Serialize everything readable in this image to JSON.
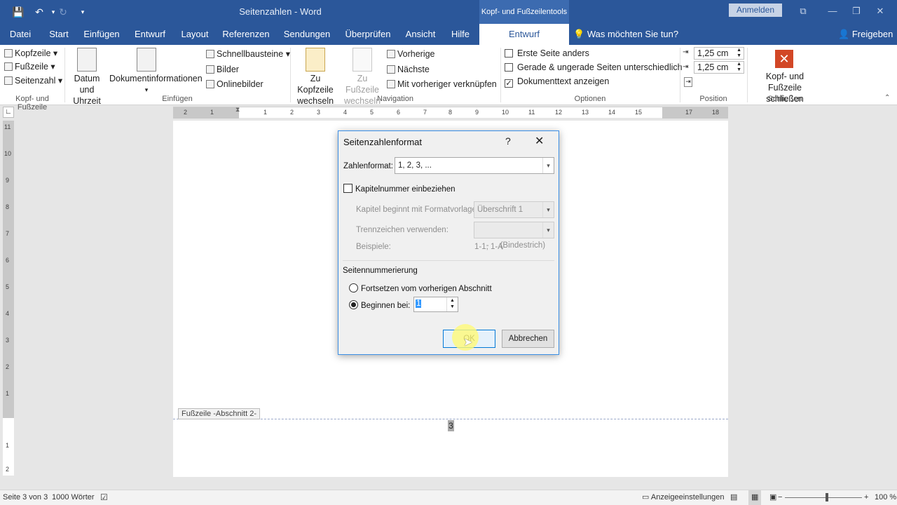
{
  "titlebar": {
    "doc_title": "Seitenzahlen  -  Word",
    "context_header": "Kopf- und Fußzeilentools",
    "signin": "Anmelden"
  },
  "tabs": [
    "Datei",
    "Start",
    "Einfügen",
    "Entwurf",
    "Layout",
    "Referenzen",
    "Sendungen",
    "Überprüfen",
    "Ansicht",
    "Hilfe",
    "Entwurf"
  ],
  "tell_me": "Was möchten Sie tun?",
  "share": "Freigeben",
  "ribbon": {
    "hf_group": {
      "kopfzeile": "Kopfzeile",
      "fusszeile": "Fußzeile",
      "seitenzahl": "Seitenzahl",
      "label": "Kopf- und Fußzeile"
    },
    "insert_group": {
      "datum_line1": "Datum und",
      "datum_line2": "Uhrzeit",
      "dokinfo": "Dokumentinformationen",
      "schnellbausteine": "Schnellbausteine",
      "bilder": "Bilder",
      "onlinebilder": "Onlinebilder",
      "label": "Einfügen"
    },
    "nav_group": {
      "zu_kopf_line1": "Zu Kopfzeile",
      "zu_kopf_line2": "wechseln",
      "zu_fuss_line1": "Zu Fußzeile",
      "zu_fuss_line2": "wechseln",
      "vorherige": "Vorherige",
      "naechste": "Nächste",
      "verknuepfen": "Mit vorheriger verknüpfen",
      "label": "Navigation"
    },
    "options_group": {
      "erste_seite": "Erste Seite anders",
      "gerade_ungerade": "Gerade & ungerade Seiten unterschiedlich",
      "dokumenttext": "Dokumenttext anzeigen",
      "label": "Optionen"
    },
    "position_group": {
      "header_pos": "1,25 cm",
      "footer_pos": "1,25 cm",
      "label": "Position"
    },
    "close_group": {
      "line1": "Kopf- und",
      "line2": "Fußzeile schließen",
      "label": "Schließen"
    }
  },
  "ruler_h_numbers": [
    "2",
    "1",
    "1",
    "2",
    "3",
    "4",
    "5",
    "6",
    "7",
    "8",
    "9",
    "10",
    "11",
    "12",
    "13",
    "14",
    "15",
    "17",
    "18"
  ],
  "ruler_v_numbers": [
    "11",
    "10",
    "9",
    "8",
    "7",
    "6",
    "5",
    "4",
    "3",
    "2",
    "1",
    "1",
    "2"
  ],
  "footer_tag": "Fußzeile -Abschnitt 2-",
  "page_number": "3",
  "dialog": {
    "title": "Seitenzahlenformat",
    "help": "?",
    "close": "✕",
    "zahlenformat_label": "Zahlenformat:",
    "zahlenformat_value": "1, 2, 3, ...",
    "kapitel_checkbox": "Kapitelnummer einbeziehen",
    "kapitel_beginnt_label": "Kapitel beginnt mit Formatvorlage:",
    "kapitel_beginnt_value": "Überschrift 1",
    "trennzeichen_label": "Trennzeichen verwenden:",
    "trennzeichen_value": "-     (Bindestrich)",
    "beispiele_label": "Beispiele:",
    "beispiele_value": "1-1, 1-A",
    "seitennummerierung": "Seitennummerierung",
    "fortsetzen": "Fortsetzen vom vorherigen Abschnitt",
    "beginnen": "Beginnen bei:",
    "beginnen_value": "1",
    "ok": "OK",
    "abbrechen": "Abbrechen"
  },
  "status": {
    "page": "Seite 3 von 3",
    "words": "1000 Wörter",
    "display": "Anzeigeeinstellungen",
    "zoom": "100 %"
  }
}
